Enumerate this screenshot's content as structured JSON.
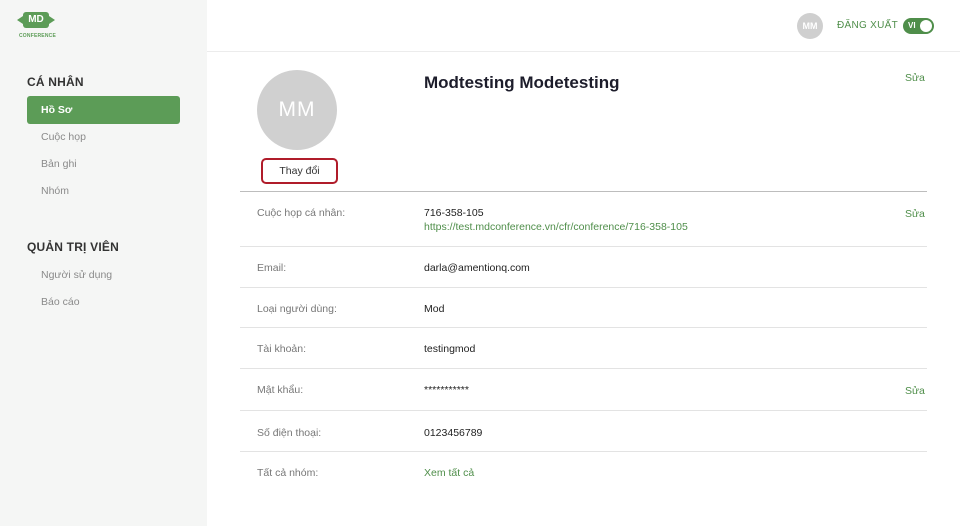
{
  "brand": {
    "logo_mark": "MD",
    "logo_text": "CONFERENCE",
    "color": "#5c9c57"
  },
  "sidebar": {
    "personal_title": "CÁ NHÂN",
    "personal_items": [
      {
        "label": "Hồ Sơ",
        "active": true
      },
      {
        "label": "Cuộc họp"
      },
      {
        "label": "Bản ghi"
      },
      {
        "label": "Nhóm"
      }
    ],
    "admin_title": "QUẢN TRỊ VIÊN",
    "admin_items": [
      {
        "label": "Người sử dụng"
      },
      {
        "label": "Báo cáo"
      }
    ]
  },
  "header": {
    "avatar_initials": "MM",
    "logout_label": "ĐĂNG XUẤT",
    "language": "VI"
  },
  "profile": {
    "avatar_initials": "MM",
    "change_label": "Thay đổi",
    "name": "Modtesting Modetesting",
    "edit_label": "Sửa",
    "fields": [
      {
        "label": "Cuộc họp cá nhân:",
        "value": "716-358-105",
        "link": "https://test.mdconference.vn/cfr/conference/716-358-105",
        "edit": "Sửa"
      },
      {
        "label": "Email:",
        "value": "darla@amentionq.com"
      },
      {
        "label": "Loại người dùng:",
        "value": "Mod"
      },
      {
        "label": "Tài khoản:",
        "value": "testingmod"
      },
      {
        "label": "Mật khẩu:",
        "value": "***********",
        "edit": "Sửa"
      },
      {
        "label": "Số điện thoại:",
        "value": "0123456789"
      },
      {
        "label": "Tất cả nhóm:",
        "link": "Xem tất cả"
      }
    ]
  }
}
